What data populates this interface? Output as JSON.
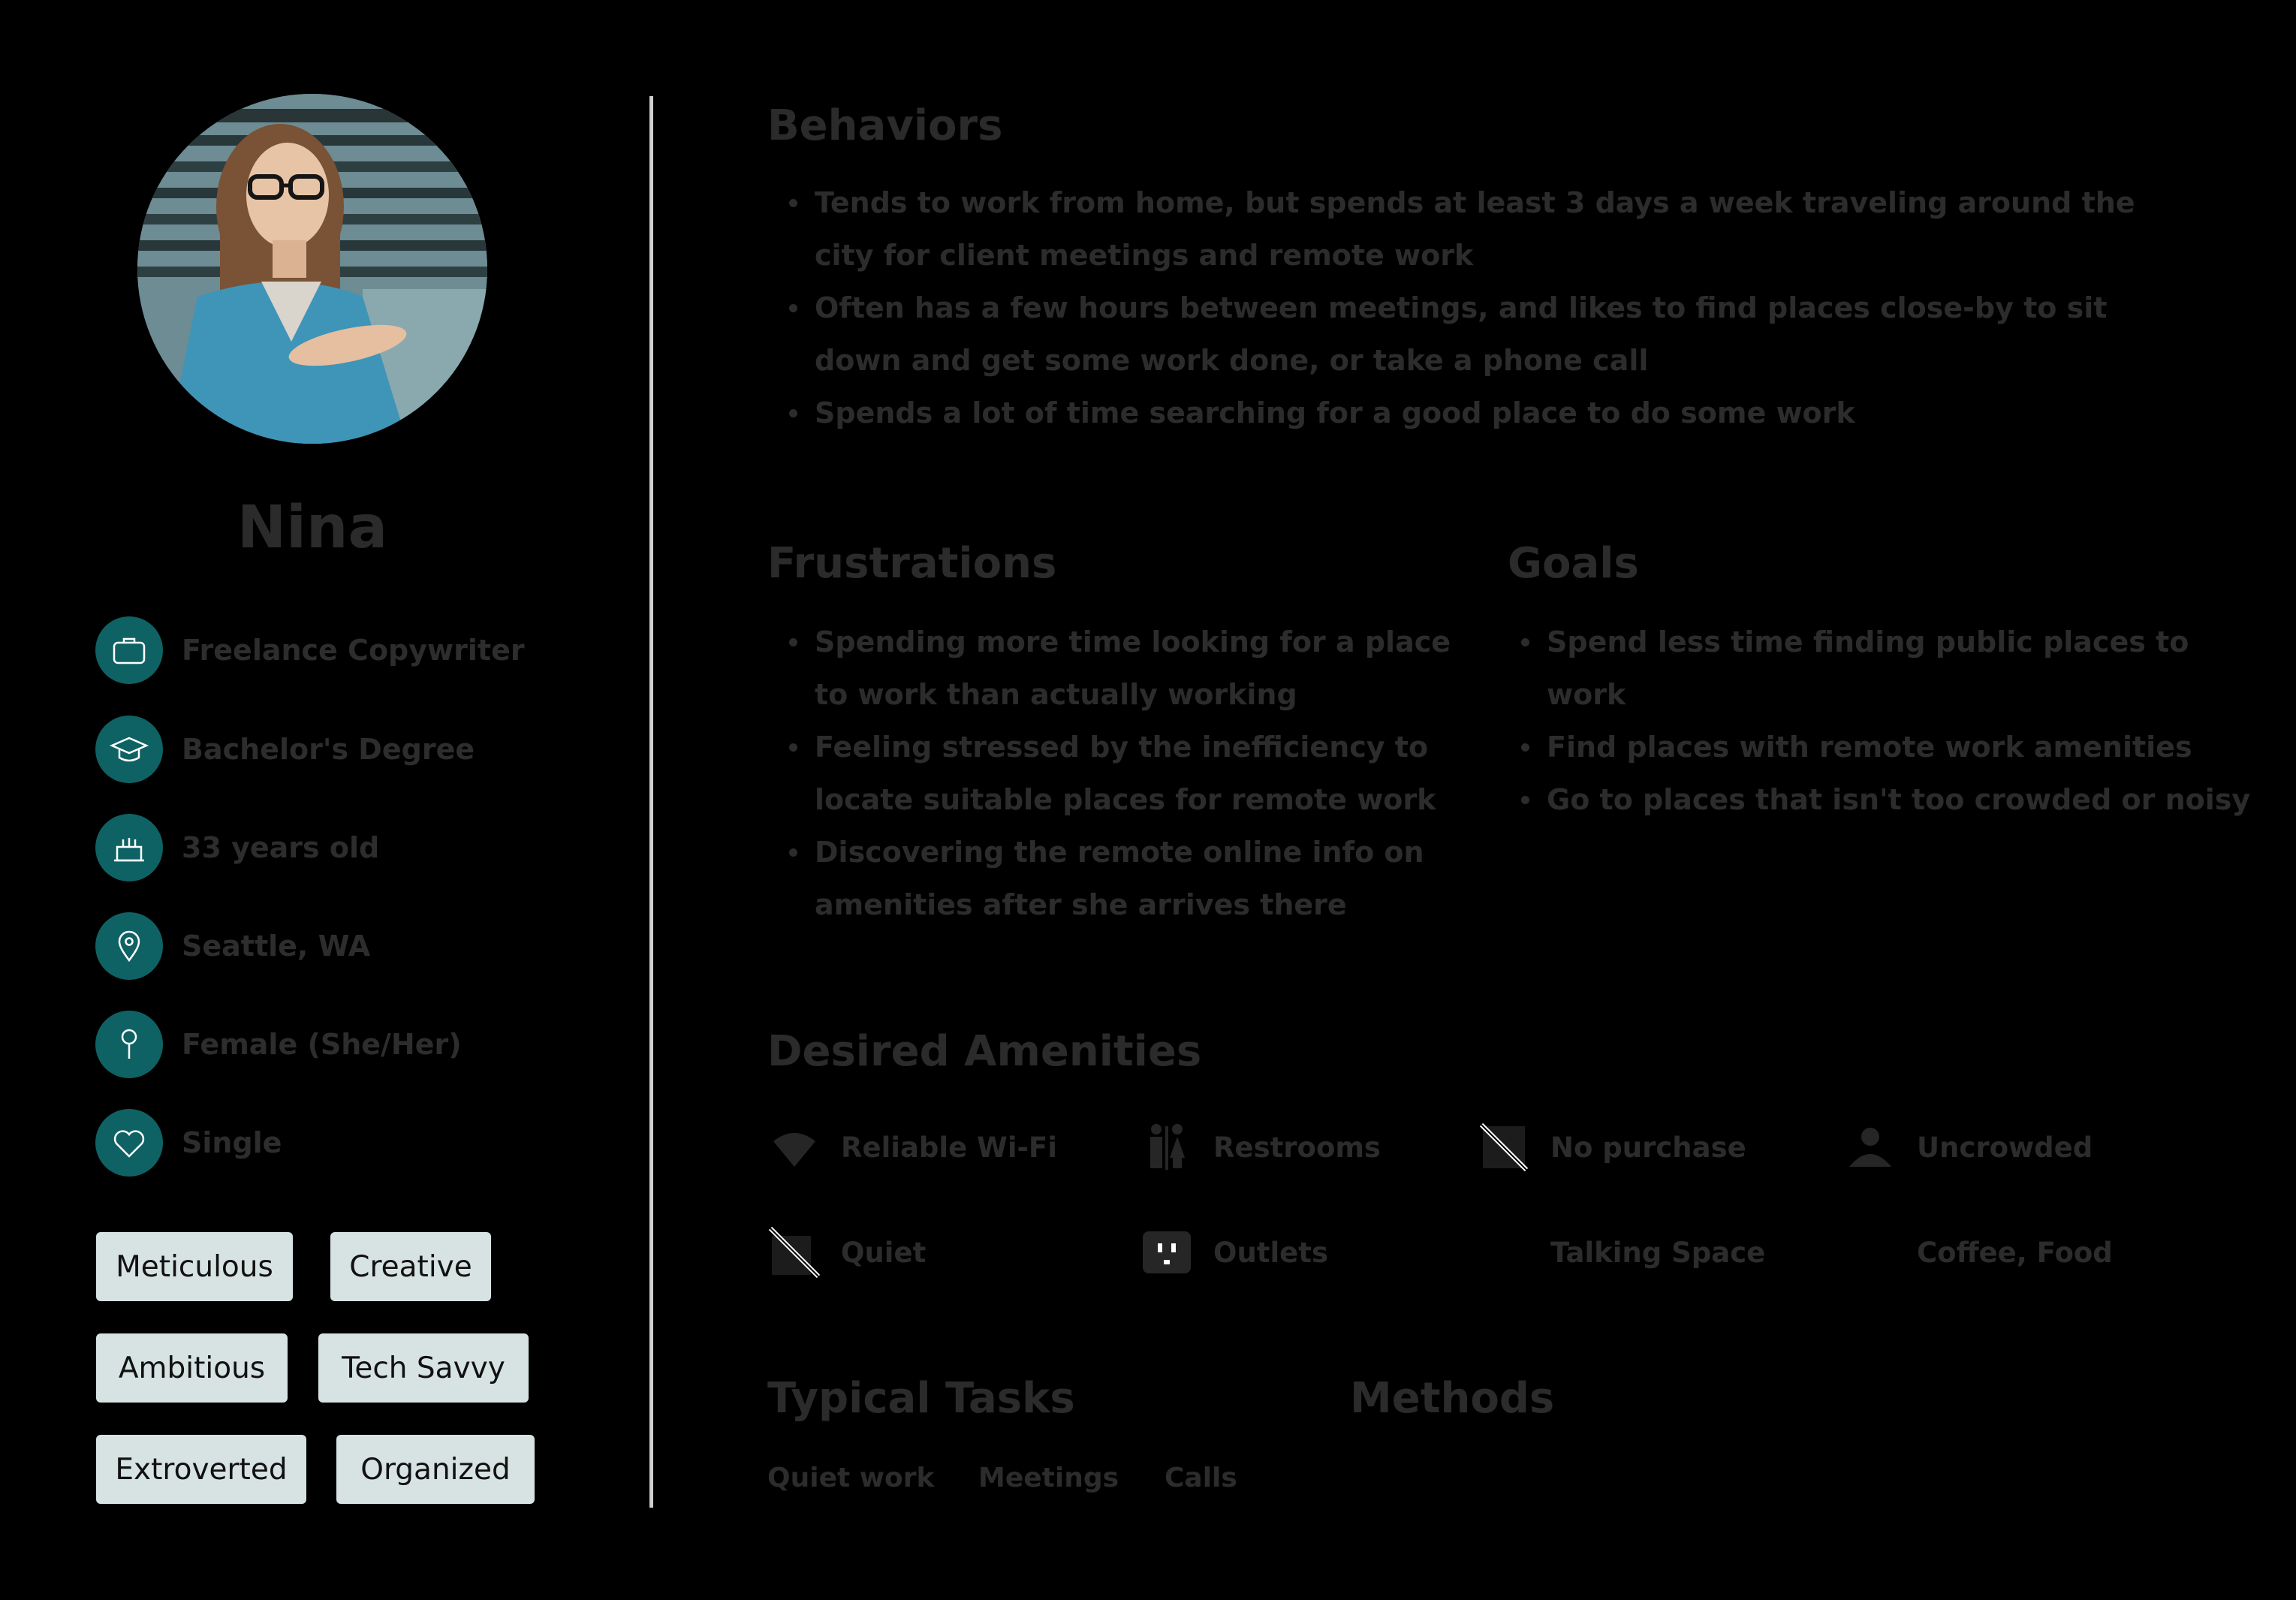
{
  "persona": {
    "name": "Nina",
    "info": [
      {
        "icon": "briefcase-icon",
        "text": "Freelance Copywriter"
      },
      {
        "icon": "graduation-cap-icon",
        "text": "Bachelor's Degree"
      },
      {
        "icon": "birthday-cake-icon",
        "text": "33 years old"
      },
      {
        "icon": "location-pin-icon",
        "text": "Seattle, WA"
      },
      {
        "icon": "gender-icon",
        "text": "Female (She/Her)"
      },
      {
        "icon": "heart-icon",
        "text": "Single"
      }
    ],
    "traits": [
      "Meticulous",
      "Creative",
      "Ambitious",
      "Tech Savvy",
      "Extroverted",
      "Organized"
    ]
  },
  "behaviors": {
    "title": "Behaviors",
    "items": [
      "Tends to work from home, but spends at least 3 days a week traveling around the city for client meetings and remote work",
      "Often has a few hours between meetings, and likes to find places close-by to sit down and get some work done, or take a phone call",
      "Spends a lot of time searching for a good place to do some work"
    ]
  },
  "frustrations": {
    "title": "Frustrations",
    "items": [
      "Spending more time looking for a place to work than actually working",
      "Feeling stressed by the inefficiency to locate suitable places for remote work",
      "Discovering the remote online info on amenities after she arrives there"
    ]
  },
  "goals": {
    "title": "Goals",
    "items": [
      "Spend less time finding public places to work",
      "Find places with remote work amenities",
      "Go to places that isn't too crowded or noisy"
    ]
  },
  "amenities": {
    "title": "Desired Amenities",
    "items": [
      {
        "icon": "wifi-icon",
        "label": "Reliable Wi-Fi"
      },
      {
        "icon": "restroom-icon",
        "label": "Restrooms"
      },
      {
        "icon": "no-purchase-icon",
        "label": "No purchase"
      },
      {
        "icon": "uncrowded-icon",
        "label": "Uncrowded"
      },
      {
        "icon": "quiet-icon",
        "label": "Quiet"
      },
      {
        "icon": "outlet-icon",
        "label": "Outlets"
      },
      {
        "icon": "",
        "label": "Talking Space"
      },
      {
        "icon": "",
        "label": "Coffee, Food"
      }
    ]
  },
  "tools": {
    "title": "Typical Tasks",
    "items": [
      "Quiet work",
      "Meetings",
      "Calls"
    ]
  },
  "methods": {
    "title": "Methods"
  },
  "colors": {
    "background": "#000000",
    "accent": "#0e6264",
    "trait_bg": "#d7e3e2",
    "divider": "#cfcfcf"
  }
}
